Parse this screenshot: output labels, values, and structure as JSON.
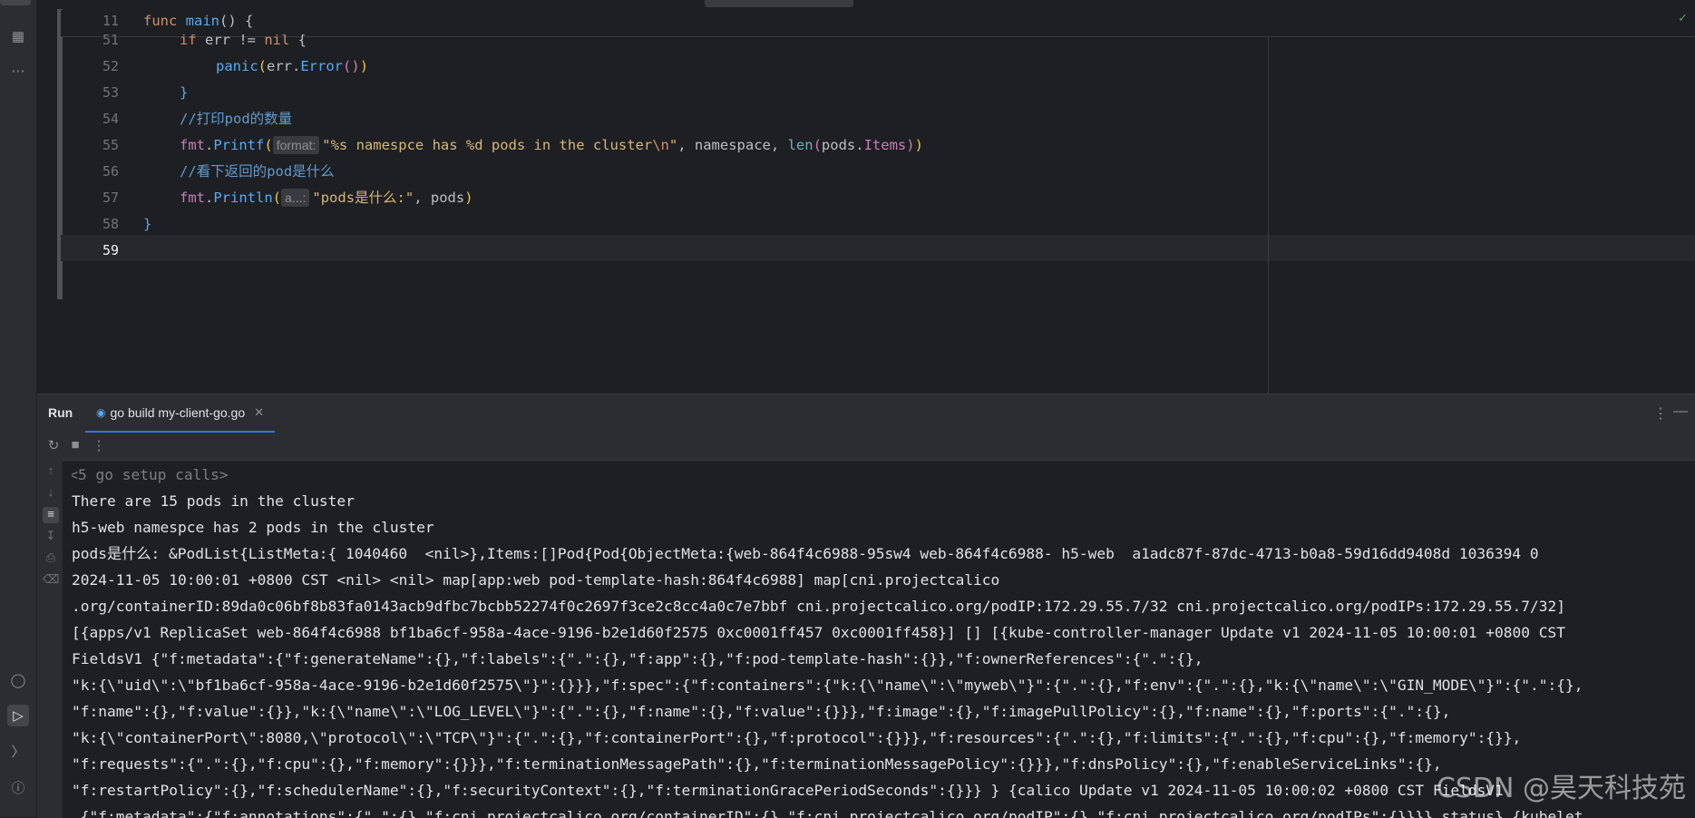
{
  "editor": {
    "sticky_line_number": "11",
    "sticky_code": "func main() {",
    "lines": [
      {
        "num": "51",
        "text": "if err != nil {"
      },
      {
        "num": "52",
        "text": "panic(err.Error())"
      },
      {
        "num": "53",
        "text": "}"
      },
      {
        "num": "54",
        "text": "//打印pod的数量"
      },
      {
        "num": "55",
        "text": "fmt.Printf(\"%s namespce has %d pods in the cluster\\n\", namespace, len(pods.Items))"
      },
      {
        "num": "56",
        "text": "//看下返回的pod是什么"
      },
      {
        "num": "57",
        "text": "fmt.Println(\"pods是什么:\", pods)"
      },
      {
        "num": "58",
        "text": "}"
      },
      {
        "num": "59",
        "text": ""
      }
    ],
    "hint_format": "format:",
    "hint_a": "a...:"
  },
  "run_panel": {
    "title": "Run",
    "tab_label": "go build my-client-go.go",
    "console_lines": [
      "<5 go setup calls>",
      "There are 15 pods in the cluster",
      "h5-web namespce has 2 pods in the cluster",
      "pods是什么: &PodList{ListMeta:{ 1040460  <nil>},Items:[]Pod{Pod{ObjectMeta:{web-864f4c6988-95sw4 web-864f4c6988- h5-web  a1adc87f-87dc-4713-b0a8-59d16dd9408d 1036394 0",
      "2024-11-05 10:00:01 +0800 CST <nil> <nil> map[app:web pod-template-hash:864f4c6988] map[cni.projectcalico",
      ".org/containerID:89da0c06bf8b83fa0143acb9dfbc7bcbb52274f0c2697f3ce2c8cc4a0c7e7bbf cni.projectcalico.org/podIP:172.29.55.7/32 cni.projectcalico.org/podIPs:172.29.55.7/32]",
      "[{apps/v1 ReplicaSet web-864f4c6988 bf1ba6cf-958a-4ace-9196-b2e1d60f2575 0xc0001ff457 0xc0001ff458}] [] [{kube-controller-manager Update v1 2024-11-05 10:00:01 +0800 CST",
      "FieldsV1 {\"f:metadata\":{\"f:generateName\":{},\"f:labels\":{\".\":{},\"f:app\":{},\"f:pod-template-hash\":{}},\"f:ownerReferences\":{\".\":{},",
      "\"k:{\\\"uid\\\":\\\"bf1ba6cf-958a-4ace-9196-b2e1d60f2575\\\"}\":{}}},\"f:spec\":{\"f:containers\":{\"k:{\\\"name\\\":\\\"myweb\\\"}\":{\".\":{},\"f:env\":{\".\":{},\"k:{\\\"name\\\":\\\"GIN_MODE\\\"}\":{\".\":{},",
      "\"f:name\":{},\"f:value\":{}},\"k:{\\\"name\\\":\\\"LOG_LEVEL\\\"}\":{\".\":{},\"f:name\":{},\"f:value\":{}}},\"f:image\":{},\"f:imagePullPolicy\":{},\"f:name\":{},\"f:ports\":{\".\":{},",
      "\"k:{\\\"containerPort\\\":8080,\\\"protocol\\\":\\\"TCP\\\"}\":{\".\":{},\"f:containerPort\":{},\"f:protocol\":{}}},\"f:resources\":{\".\":{},\"f:limits\":{\".\":{},\"f:cpu\":{},\"f:memory\":{}},",
      "\"f:requests\":{\".\":{},\"f:cpu\":{},\"f:memory\":{}}},\"f:terminationMessagePath\":{},\"f:terminationMessagePolicy\":{}}},\"f:dnsPolicy\":{},\"f:enableServiceLinks\":{},",
      "\"f:restartPolicy\":{},\"f:schedulerName\":{},\"f:securityContext\":{},\"f:terminationGracePeriodSeconds\":{}}} } {calico Update v1 2024-11-05 10:00:02 +0800 CST FieldsV1",
      " {\"f:metadata\":{\"f:annotations\":{\".\":{},\"f:cni.projectcalico.org/containerID\":{},\"f:cni.projectcalico.org/podIP\":{},\"f:cni.projectcalico.org/podIPs\":{}}}} status} {kubelet"
    ]
  },
  "watermark": "CSDN @昊天科技苑"
}
